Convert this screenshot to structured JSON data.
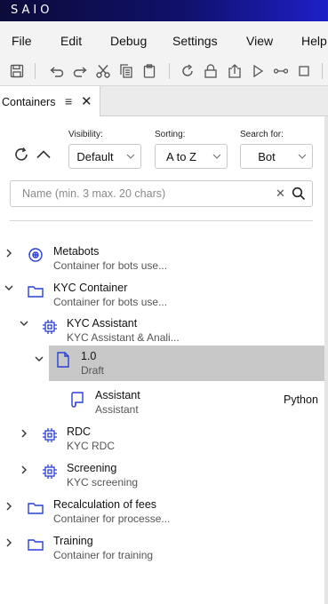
{
  "app": {
    "brand": "SAIO"
  },
  "menu": [
    "File",
    "Edit",
    "Debug",
    "Settings",
    "View",
    "Help"
  ],
  "toolbar": {
    "icons": [
      "save-icon",
      "undo-icon",
      "redo-icon",
      "cut-icon",
      "copy-icon",
      "paste-icon",
      "refresh-icon",
      "lock-icon",
      "export-icon",
      "run-icon",
      "step-icon",
      "stop-icon"
    ]
  },
  "tab": {
    "label": "Containers",
    "menu_glyph": "≡",
    "close_glyph": "✕"
  },
  "filters": {
    "visibility": {
      "label": "Visibility:",
      "value": "Default"
    },
    "sorting": {
      "label": "Sorting:",
      "value": "A to Z"
    },
    "search_for": {
      "label": "Search for:",
      "value": "Bot"
    }
  },
  "search": {
    "placeholder": "Name (min. 3 max. 20 chars)",
    "value": "",
    "clear_glyph": "✕"
  },
  "tree": [
    {
      "title": "Metabots",
      "subtitle": "Container for bots use...",
      "icon": "metabot-icon",
      "expanded": false
    },
    {
      "title": "KYC Container",
      "subtitle": "Container for bots use...",
      "icon": "folder-icon",
      "expanded": true
    },
    {
      "title": "KYC Assistant",
      "subtitle": "KYC Assistant & Anali...",
      "icon": "chip-icon",
      "expanded": true
    },
    {
      "title": "1.0",
      "subtitle": "Draft",
      "icon": "document-icon",
      "expanded": true,
      "selected": true
    },
    {
      "title": "Assistant",
      "subtitle": "Assistant",
      "icon": "script-icon",
      "language": "Python"
    },
    {
      "title": "RDC",
      "subtitle": "KYC RDC",
      "icon": "chip-icon",
      "expanded": false
    },
    {
      "title": "Screening",
      "subtitle": "KYC screening",
      "icon": "chip-icon",
      "expanded": false
    },
    {
      "title": "Recalculation of fees",
      "subtitle": "Container for processe...",
      "icon": "folder-icon",
      "expanded": false
    },
    {
      "title": "Training",
      "subtitle": "Container for training",
      "icon": "folder-icon",
      "expanded": false
    }
  ],
  "colors": {
    "accent": "#2a3fd6",
    "titlebar_start": "#0b0b3a",
    "titlebar_end": "#1e20c8",
    "selected_row": "#c8c8c8"
  }
}
